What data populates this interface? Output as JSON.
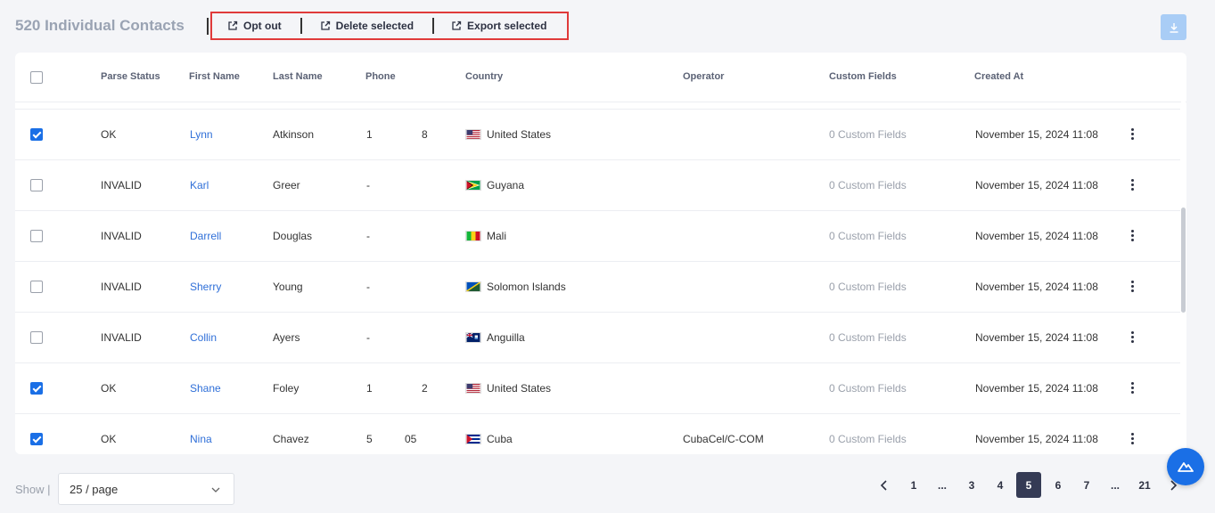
{
  "header": {
    "title": "520 Individual Contacts",
    "actions": {
      "opt_out": "Opt out",
      "delete_selected": "Delete selected",
      "export_selected": "Export selected"
    }
  },
  "table": {
    "columns": {
      "parse_status": "Parse Status",
      "first_name": "First Name",
      "last_name": "Last Name",
      "phone": "Phone",
      "country": "Country",
      "operator": "Operator",
      "custom_fields": "Custom Fields",
      "created_at": "Created At"
    },
    "rows": [
      {
        "checked": true,
        "status": "OK",
        "first": "Lynn",
        "last": "Atkinson",
        "phone_a": "1",
        "phone_b": "8",
        "country": "United States",
        "flag": "us-flag",
        "operator": "",
        "custom": "0 Custom Fields",
        "created": "November 15, 2024 11:08"
      },
      {
        "checked": false,
        "status": "INVALID",
        "first": "Karl",
        "last": "Greer",
        "phone_a": "-",
        "phone_b": "",
        "country": "Guyana",
        "flag": "guyana-flag",
        "operator": "",
        "custom": "0 Custom Fields",
        "created": "November 15, 2024 11:08"
      },
      {
        "checked": false,
        "status": "INVALID",
        "first": "Darrell",
        "last": "Douglas",
        "phone_a": "-",
        "phone_b": "",
        "country": "Mali",
        "flag": "mali-flag",
        "operator": "",
        "custom": "0 Custom Fields",
        "created": "November 15, 2024 11:08"
      },
      {
        "checked": false,
        "status": "INVALID",
        "first": "Sherry",
        "last": "Young",
        "phone_a": "-",
        "phone_b": "",
        "country": "Solomon Islands",
        "flag": "solomon-islands-flag",
        "operator": "",
        "custom": "0 Custom Fields",
        "created": "November 15, 2024 11:08"
      },
      {
        "checked": false,
        "status": "INVALID",
        "first": "Collin",
        "last": "Ayers",
        "phone_a": "-",
        "phone_b": "",
        "country": "Anguilla",
        "flag": "anguilla-flag",
        "operator": "",
        "custom": "0 Custom Fields",
        "created": "November 15, 2024 11:08"
      },
      {
        "checked": true,
        "status": "OK",
        "first": "Shane",
        "last": "Foley",
        "phone_a": "1",
        "phone_b": "2",
        "country": "United States",
        "flag": "us-flag",
        "operator": "",
        "custom": "0 Custom Fields",
        "created": "November 15, 2024 11:08"
      },
      {
        "checked": true,
        "status": "OK",
        "first": "Nina",
        "last": "Chavez",
        "phone_a": "5",
        "phone_b": "05",
        "country": "Cuba",
        "flag": "cuba-flag",
        "operator": "CubaCel/C-COM",
        "custom": "0 Custom Fields",
        "created": "November 15, 2024 11:08"
      }
    ]
  },
  "footer": {
    "show_label": "Show |",
    "page_size": "25 / page",
    "pages": [
      "1",
      "...",
      "3",
      "4",
      "5",
      "6",
      "7",
      "...",
      "21"
    ],
    "current_page": "5"
  },
  "colors": {
    "accent": "#1a6fe6",
    "highlight_border": "#e03a3a",
    "active_page": "#353b55"
  }
}
